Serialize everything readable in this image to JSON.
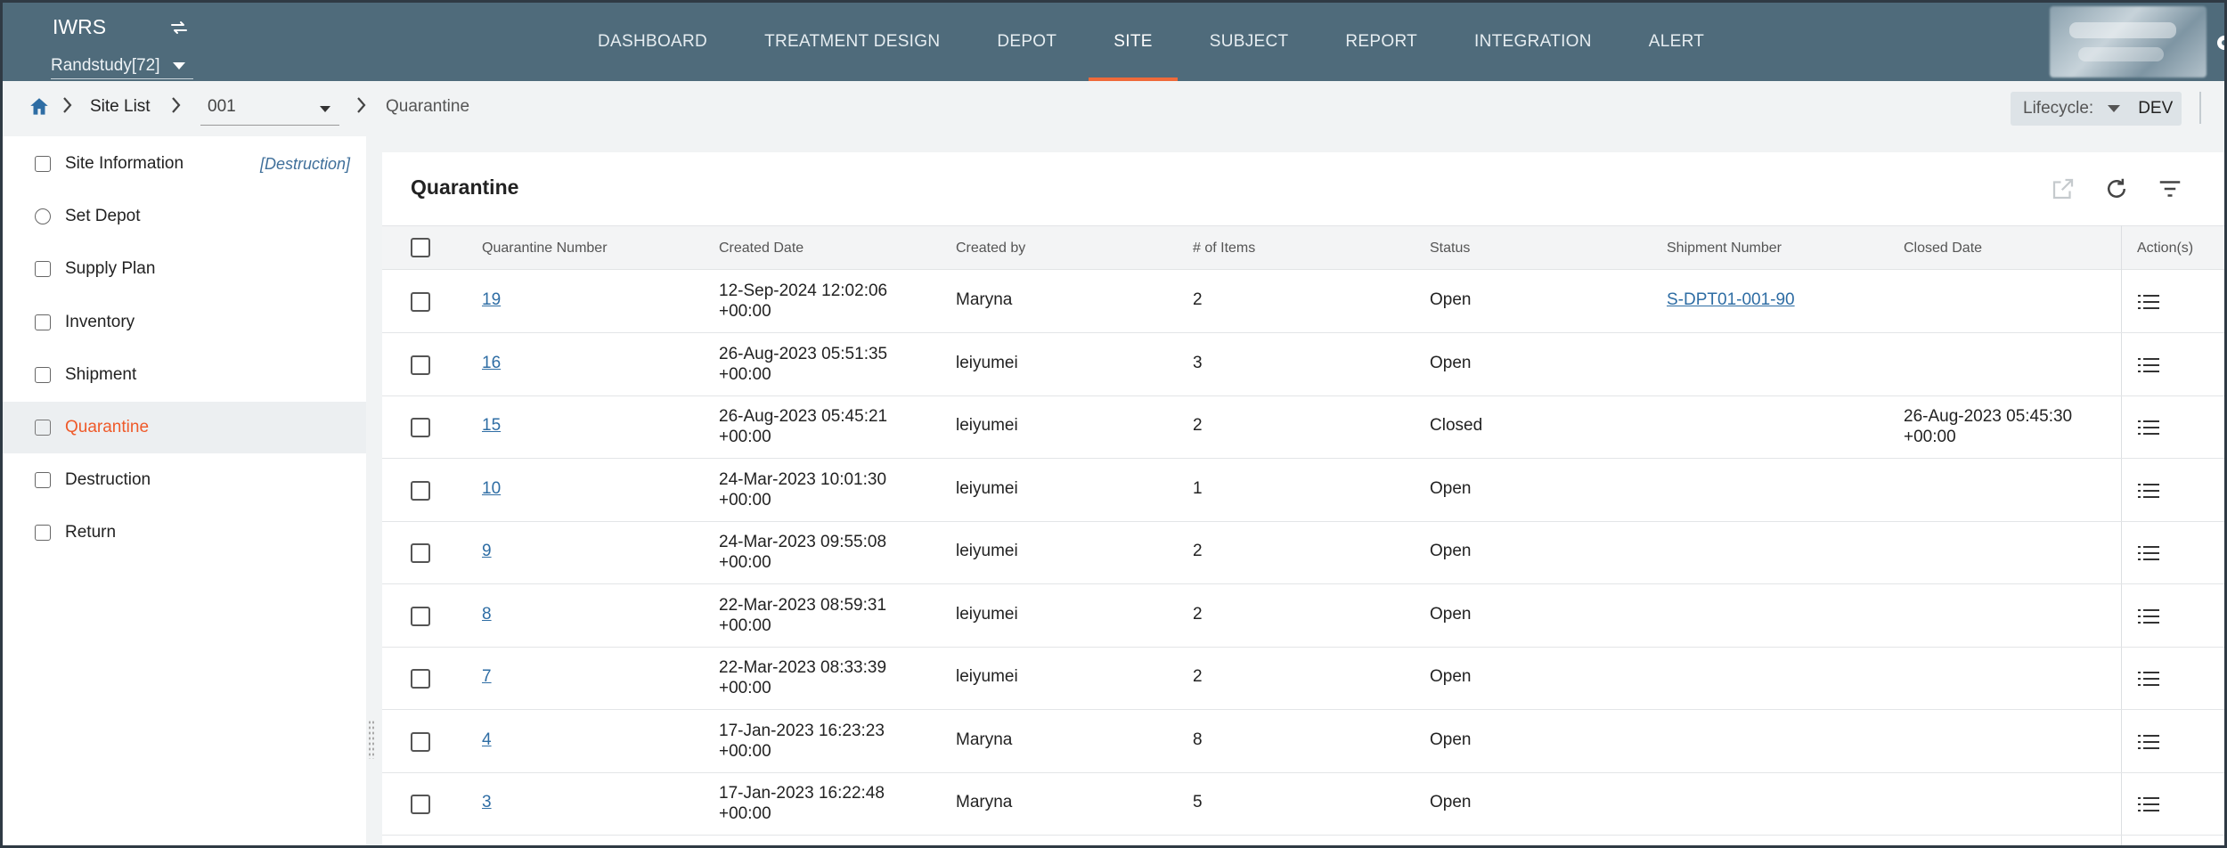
{
  "app": {
    "title": "IWRS",
    "study": "Randstudy[72]"
  },
  "nav": [
    "DASHBOARD",
    "TREATMENT DESIGN",
    "DEPOT",
    "SITE",
    "SUBJECT",
    "REPORT",
    "INTEGRATION",
    "ALERT"
  ],
  "nav_active": "SITE",
  "breadcrumb": {
    "site_list": "Site List",
    "site": "001",
    "current": "Quarantine"
  },
  "lifecycle": {
    "label": "Lifecycle:",
    "value": "DEV"
  },
  "sidebar": {
    "items": [
      {
        "label": "Site Information",
        "tag": "[Destruction]"
      },
      {
        "label": "Set Depot"
      },
      {
        "label": "Supply Plan"
      },
      {
        "label": "Inventory"
      },
      {
        "label": "Shipment"
      },
      {
        "label": "Quarantine"
      },
      {
        "label": "Destruction"
      },
      {
        "label": "Return"
      }
    ],
    "active": "Quarantine"
  },
  "panel": {
    "title": "Quarantine"
  },
  "table": {
    "headers": [
      "Quarantine Number",
      "Created Date",
      "Created by",
      "# of Items",
      "Status",
      "Shipment Number",
      "Closed Date",
      "Action(s)"
    ],
    "rows": [
      {
        "num": "19",
        "date1": "12-Sep-2024 12:02:06",
        "date2": "+00:00",
        "by": "Maryna",
        "items": "2",
        "status": "Open",
        "shipment": "S-DPT01-001-90",
        "closed1": "",
        "closed2": ""
      },
      {
        "num": "16",
        "date1": "26-Aug-2023 05:51:35",
        "date2": "+00:00",
        "by": "leiyumei",
        "items": "3",
        "status": "Open",
        "shipment": "",
        "closed1": "",
        "closed2": ""
      },
      {
        "num": "15",
        "date1": "26-Aug-2023 05:45:21",
        "date2": "+00:00",
        "by": "leiyumei",
        "items": "2",
        "status": "Closed",
        "shipment": "",
        "closed1": "26-Aug-2023 05:45:30",
        "closed2": "+00:00"
      },
      {
        "num": "10",
        "date1": "24-Mar-2023 10:01:30",
        "date2": "+00:00",
        "by": "leiyumei",
        "items": "1",
        "status": "Open",
        "shipment": "",
        "closed1": "",
        "closed2": ""
      },
      {
        "num": "9",
        "date1": "24-Mar-2023 09:55:08",
        "date2": "+00:00",
        "by": "leiyumei",
        "items": "2",
        "status": "Open",
        "shipment": "",
        "closed1": "",
        "closed2": ""
      },
      {
        "num": "8",
        "date1": "22-Mar-2023 08:59:31",
        "date2": "+00:00",
        "by": "leiyumei",
        "items": "2",
        "status": "Open",
        "shipment": "",
        "closed1": "",
        "closed2": ""
      },
      {
        "num": "7",
        "date1": "22-Mar-2023 08:33:39",
        "date2": "+00:00",
        "by": "leiyumei",
        "items": "2",
        "status": "Open",
        "shipment": "",
        "closed1": "",
        "closed2": ""
      },
      {
        "num": "4",
        "date1": "17-Jan-2023 16:23:23",
        "date2": "+00:00",
        "by": "Maryna",
        "items": "8",
        "status": "Open",
        "shipment": "",
        "closed1": "",
        "closed2": ""
      },
      {
        "num": "3",
        "date1": "17-Jan-2023 16:22:48",
        "date2": "+00:00",
        "by": "Maryna",
        "items": "5",
        "status": "Open",
        "shipment": "",
        "closed1": "",
        "closed2": ""
      }
    ]
  },
  "colors": {
    "topbar": "#4f6b7b",
    "accent": "#ef5a2a",
    "link": "#2e6da4"
  }
}
